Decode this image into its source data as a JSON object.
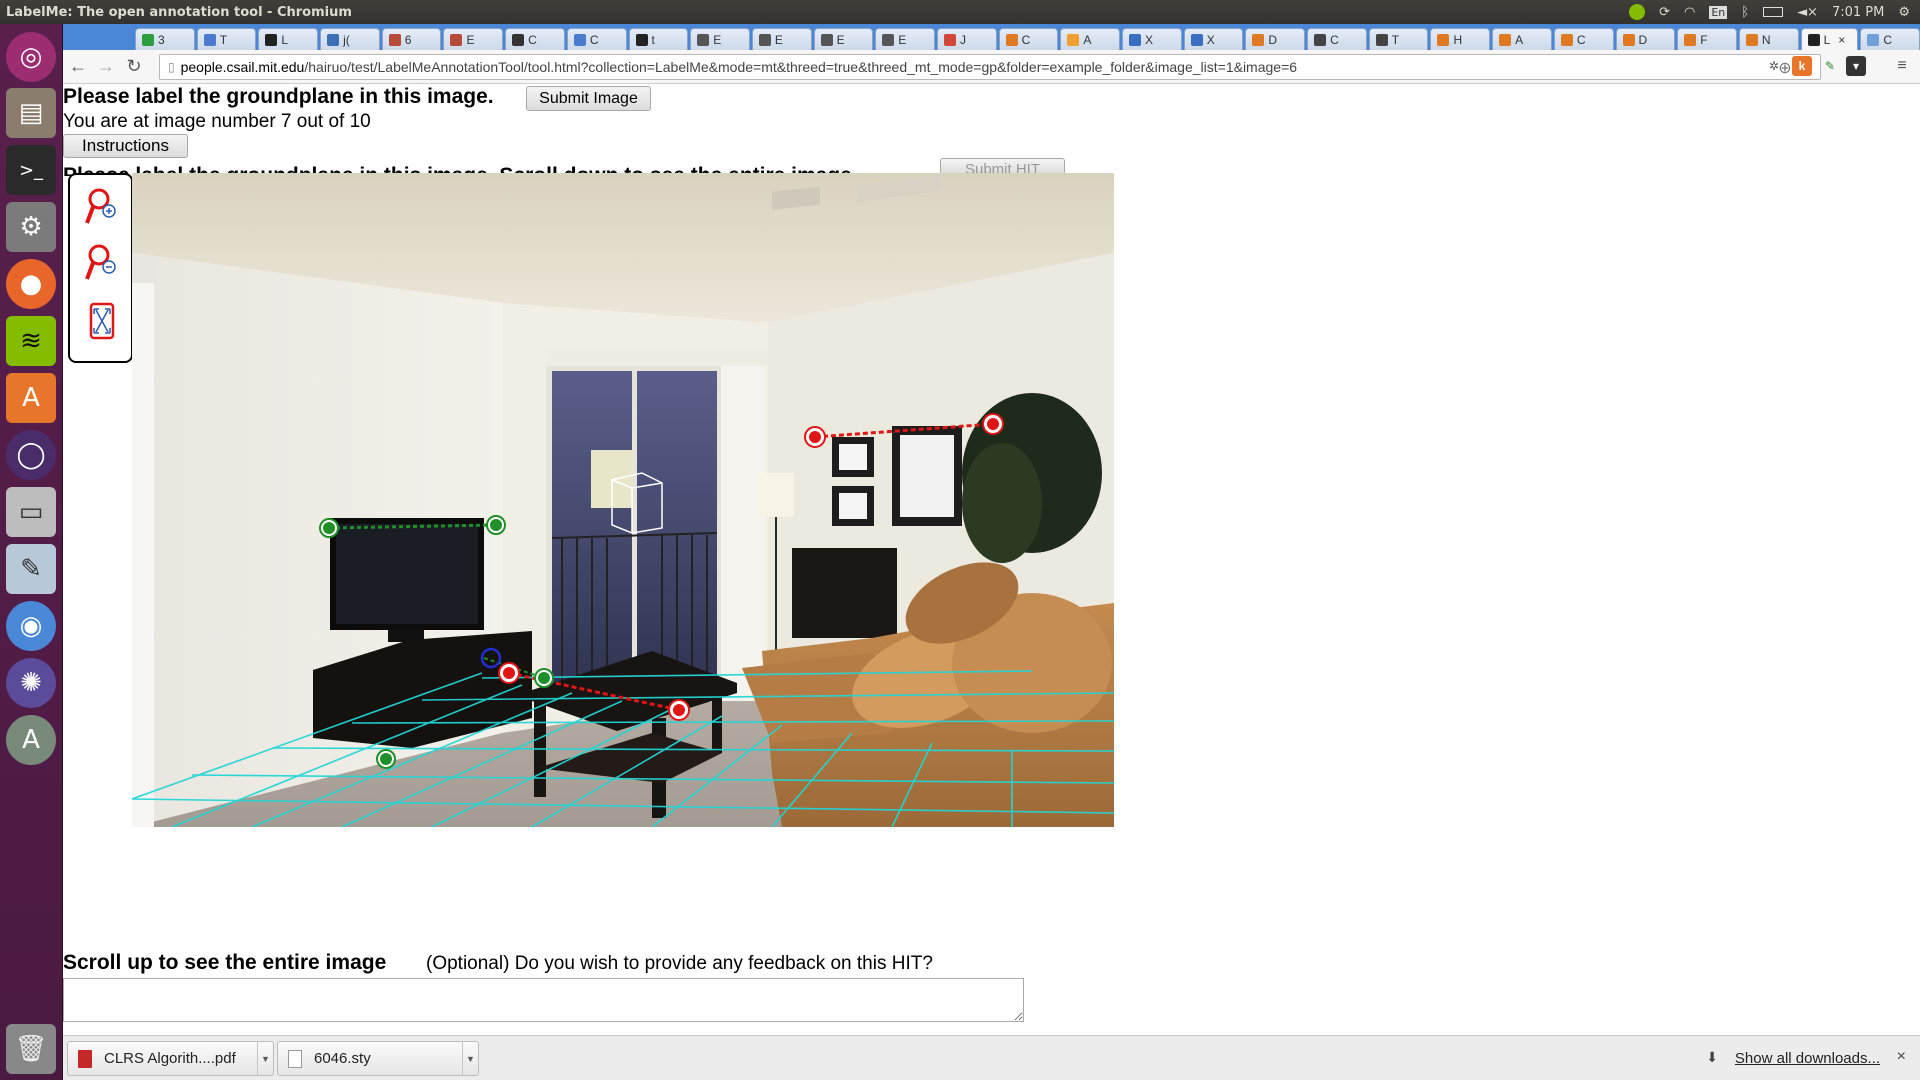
{
  "window": {
    "title": "LabelMe: The open annotation tool - Chromium",
    "tray": {
      "keyboard": "En",
      "time": "7:01 PM"
    }
  },
  "tabs": [
    {
      "label": "3",
      "color": "#2d9e3e"
    },
    {
      "label": "T",
      "color": "#4a7bd0"
    },
    {
      "label": "L",
      "color": "#222222"
    },
    {
      "label": "j(",
      "color": "#3c6fb6"
    },
    {
      "label": "6",
      "color": "#b84a3a"
    },
    {
      "label": "E",
      "color": "#b84a3a"
    },
    {
      "label": "C",
      "color": "#333333"
    },
    {
      "label": "C",
      "color": "#4a7bd0"
    },
    {
      "label": "t",
      "color": "#222222"
    },
    {
      "label": "E",
      "color": "#555555"
    },
    {
      "label": "E",
      "color": "#555555"
    },
    {
      "label": "E",
      "color": "#555555"
    },
    {
      "label": "E",
      "color": "#555555"
    },
    {
      "label": "J",
      "color": "#d44638"
    },
    {
      "label": "C",
      "color": "#e07a22"
    },
    {
      "label": "A",
      "color": "#f0a030"
    },
    {
      "label": "X",
      "color": "#3a6ec0"
    },
    {
      "label": "X",
      "color": "#3a6ec0"
    },
    {
      "label": "D",
      "color": "#e07a22"
    },
    {
      "label": "C",
      "color": "#444444"
    },
    {
      "label": "T",
      "color": "#444444"
    },
    {
      "label": "H",
      "color": "#e07a22"
    },
    {
      "label": "A",
      "color": "#e07a22"
    },
    {
      "label": "C",
      "color": "#e07a22"
    },
    {
      "label": "D",
      "color": "#e07a22"
    },
    {
      "label": "F",
      "color": "#e07a22"
    },
    {
      "label": "N",
      "color": "#e07a22"
    },
    {
      "label": "L",
      "color": "#222222",
      "active": true
    },
    {
      "label": "C",
      "color": "#6fa0d8"
    }
  ],
  "tab_close": "×",
  "address": {
    "host": "people.csail.mit.edu",
    "path": "/hairuo/test/LabelMeAnnotationTool/tool.html?collection=LabelMe&mode=mt&threed=true&threed_mt_mode=gp&folder=example_folder&image_list=1&image=6"
  },
  "page": {
    "heading": "Please label the groundplane in this image.",
    "submit_image": "Submit Image",
    "progress_text": "You are at image number 7 out of 10",
    "instructions": "Instructions",
    "heading2": "Please label the groundplane in this image. Scroll down to see the entire image.",
    "submit_hit": "Submit HIT",
    "scroll_up": "Scroll up to see the entire image",
    "feedback_prompt": "(Optional) Do you wish to provide any feedback on this HIT?"
  },
  "downloads": {
    "items": [
      {
        "name": "CLRS Algorith....pdf"
      },
      {
        "name": "6046.sty"
      }
    ],
    "show_all": "Show all downloads...",
    "close": "×"
  },
  "colors": {
    "ground_grid": "#21d6d6",
    "handle_green": "#1f8f2a",
    "handle_red": "#e01515",
    "handle_blue": "#2030d0"
  }
}
